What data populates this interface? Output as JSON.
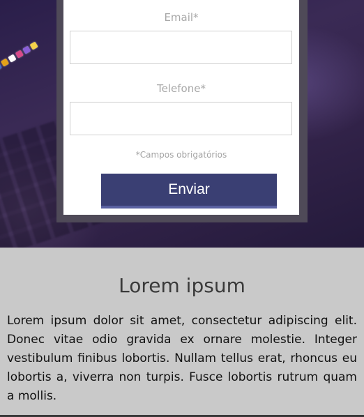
{
  "form": {
    "email_label": "Email*",
    "email_value": "",
    "phone_label": "Telefone*",
    "phone_value": "",
    "required_note": "*Campos obrigatórios",
    "submit_label": "Enviar"
  },
  "content": {
    "title": "Lorem ipsum",
    "body": "Lorem ipsum dolor sit amet, consectetur adipiscing elit. Donec vitae odio gravida ex ornare molestie. Integer vestibulum finibus lobortis. Nullam tellus erat, rhoncus eu lobortis a, viverra non turpis. Fusce lobortis rutrum quam a mollis."
  },
  "colors": {
    "button": "#3a3f73",
    "hero": "#2a1e4a",
    "content_bg": "#c9c9c9"
  }
}
